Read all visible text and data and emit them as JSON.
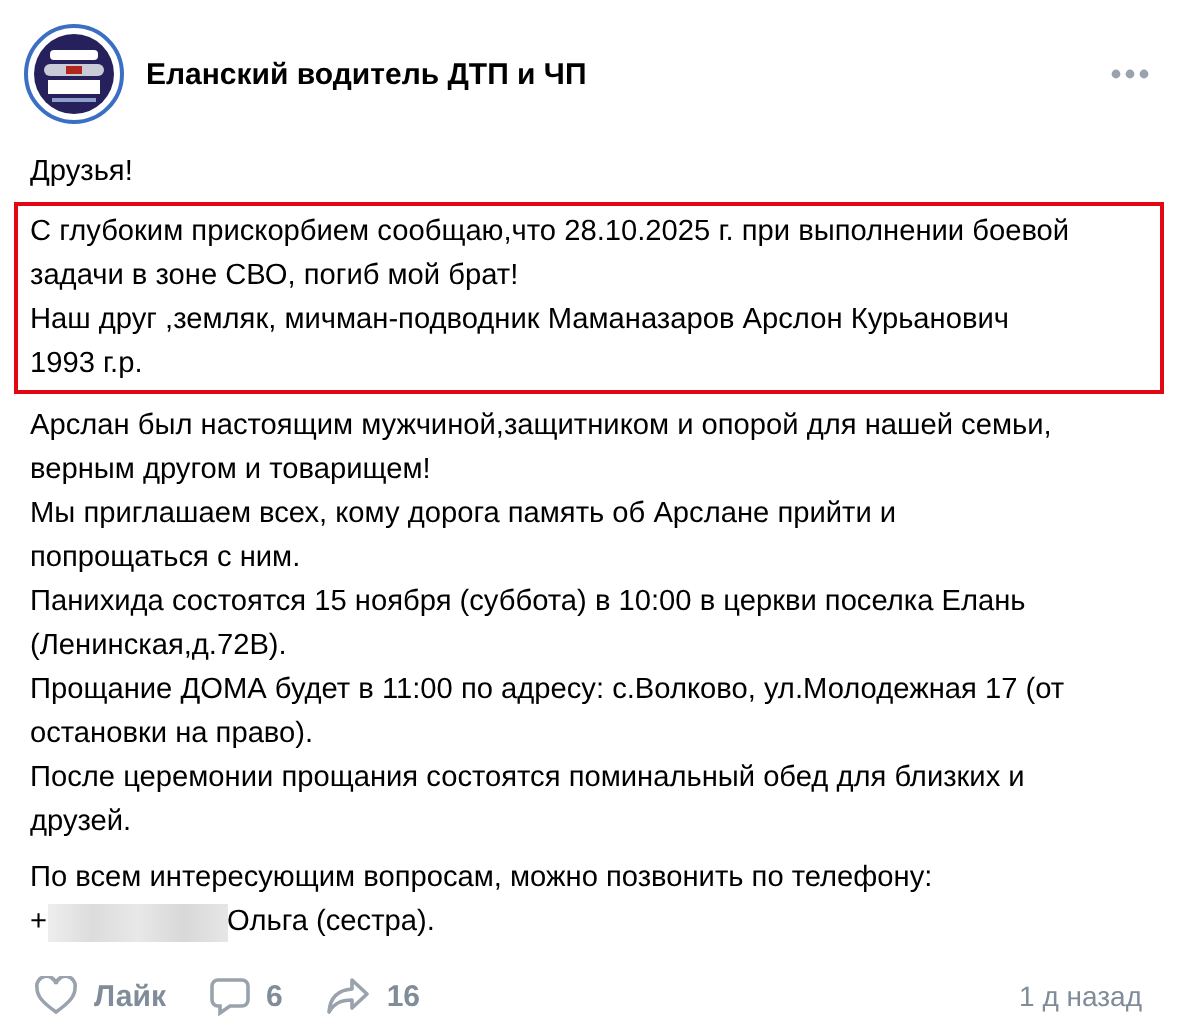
{
  "post": {
    "author": "Еланский водитель ДТП и ЧП",
    "greeting": "Друзья!",
    "highlighted_lines": [
      "С глубоким прискорбием сообщаю,что 28.10.2025 г. при выполнении боевой",
      "задачи в зоне СВО, погиб мой брат!",
      "Наш друг ,земляк, мичман-подводник Маманазаров Арслон Курьанович",
      "1993 г.р."
    ],
    "body_lines": [
      "Арслан был настоящим мужчиной,защитником и опорой для нашей семьи,",
      "верным другом и товарищем!",
      "Мы приглашаем всех, кому дорога память об Арслане прийти и",
      "попрощаться с ним.",
      "Панихида состоятся 15 ноября (суббота) в 10:00 в церкви поселка Елань",
      "(Ленинская,д.72В).",
      "Прощание ДОМА будет в 11:00 по адресу: с.Волково, ул.Молодежная 17 (от",
      "остановки на право).",
      "После церемонии прощания состоятся поминальный обед для близких и",
      "друзей."
    ],
    "contact_line": "По всем интересующим вопросам, можно позвонить по телефону:",
    "phone_prefix": "+",
    "phone_redacted": true,
    "contact_name": "Ольга (сестра)."
  },
  "footer": {
    "like_label": "Лайк",
    "liked": false,
    "comments": "6",
    "shares": "16",
    "time": "1 д назад"
  }
}
